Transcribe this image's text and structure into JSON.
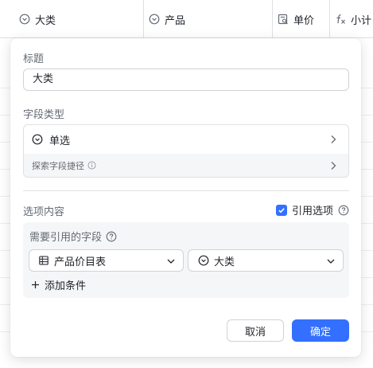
{
  "table": {
    "columns": [
      {
        "label": "大类",
        "icon": "single-select-icon"
      },
      {
        "label": "产品",
        "icon": "single-select-icon"
      },
      {
        "label": "单价",
        "icon": "lookup-icon"
      },
      {
        "label": "小计",
        "icon": "formula-icon"
      }
    ]
  },
  "dialog": {
    "title_label": "标题",
    "title_value": "大类",
    "field_type_label": "字段类型",
    "field_type_value": "单选",
    "explore_label": "探索字段捷径",
    "options_label": "选项内容",
    "reference_toggle_label": "引用选项",
    "reference_toggle_checked": true,
    "reference_field_label": "需要引用的字段",
    "reference_table": "产品价目表",
    "reference_field": "大类",
    "add_condition_label": "添加条件",
    "cancel_label": "取消",
    "confirm_label": "确定"
  },
  "colors": {
    "primary": "#3370ff",
    "border": "#d0d3d6",
    "panel_bg": "#f5f6f7",
    "text": "#1f2329",
    "secondary_text": "#646a73"
  }
}
